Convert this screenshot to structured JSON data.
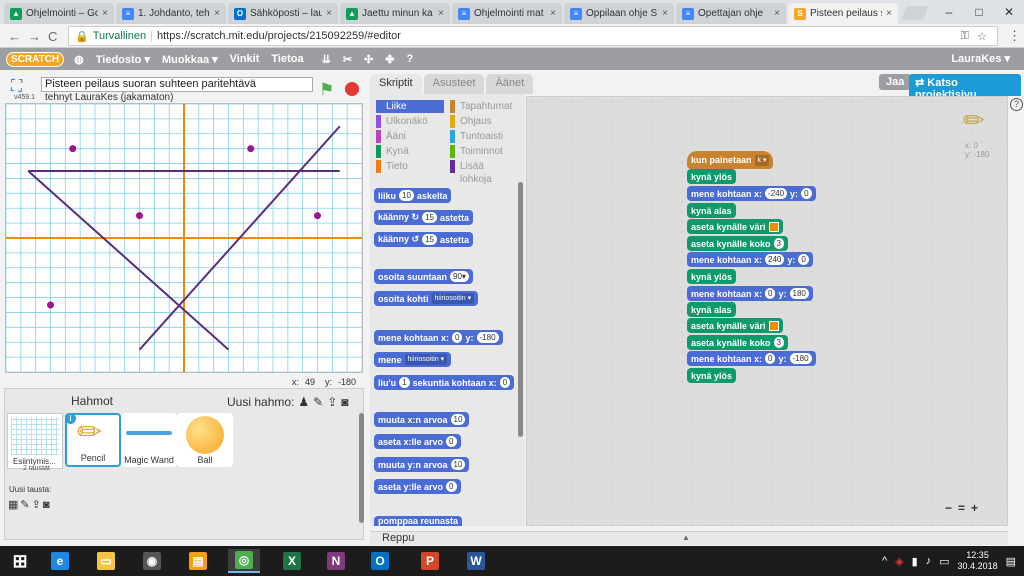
{
  "browser": {
    "tabs": [
      {
        "label": "Ohjelmointi – Go",
        "color": "#0f9d58",
        "glyph": "▲"
      },
      {
        "label": "1. Johdanto, teht",
        "color": "#4285f4",
        "glyph": "≡"
      },
      {
        "label": "Sähköposti – lau",
        "color": "#0072c6",
        "glyph": "O"
      },
      {
        "label": "Jaettu minun ka",
        "color": "#0f9d58",
        "glyph": "▲"
      },
      {
        "label": "Ohjelmointi mat",
        "color": "#4285f4",
        "glyph": "≡"
      },
      {
        "label": "Oppilaan ohje S",
        "color": "#4285f4",
        "glyph": "≡"
      },
      {
        "label": "Opettajan ohje",
        "color": "#4285f4",
        "glyph": "≡"
      },
      {
        "label": "Pisteen peilaus s",
        "color": "#f6a623",
        "glyph": "S"
      }
    ],
    "tab_close": "×",
    "secure_label": "Turvallinen",
    "url": "https://scratch.mit.edu/projects/215092259/#editor",
    "nav": [
      "←",
      "→",
      "C"
    ],
    "min": "–",
    "max": "□",
    "close": "✕"
  },
  "menu": {
    "logo": "SCRATCH",
    "items": [
      "Tiedosto ▾",
      "Muokkaa ▾",
      "Vinkit",
      "Tietoa"
    ],
    "user": "LauraKes ▾",
    "share": "Jaa",
    "see_project": "Katso projektisivu"
  },
  "stage": {
    "project_name": "Pisteen peilaus suoran suhteen paritehtävä",
    "byline": "tehnyt LauraKes (jakamaton)",
    "version": "v459.1",
    "coord_x_label": "x:",
    "coord_x": "49",
    "coord_y_label": "y:",
    "coord_y": "-180"
  },
  "sprites": {
    "header": "Hahmot",
    "new_label": "Uusi hahmo:",
    "stage_name": "Esiintymis...",
    "stage_count": "2 taustat",
    "new_bg": "Uusi tausta:",
    "list": [
      "Pencil",
      "Magic Wand",
      "Ball"
    ]
  },
  "tabs": [
    "Skriptit",
    "Asusteet",
    "Äänet"
  ],
  "categories": [
    {
      "label": "Liike",
      "color": "#4a6cd4"
    },
    {
      "label": "Tapahtumat",
      "color": "#c88330"
    },
    {
      "label": "Ulkonäkö",
      "color": "#8a55d7"
    },
    {
      "label": "Ohjaus",
      "color": "#e1a91a"
    },
    {
      "label": "Ääni",
      "color": "#bb42c3"
    },
    {
      "label": "Tuntoaisti",
      "color": "#2ca5e2"
    },
    {
      "label": "Kynä",
      "color": "#0e9a57"
    },
    {
      "label": "Toiminnot",
      "color": "#5cb712"
    },
    {
      "label": "Tieto",
      "color": "#ee7d16"
    },
    {
      "label": "Lisää lohkoja",
      "color": "#632d99"
    }
  ],
  "palette": {
    "move": "liiku",
    "move_n": "10",
    "steps": "askelta",
    "turn_r": "käänny ↻",
    "turn_n": "15",
    "degrees": "astetta",
    "turn_l": "käänny ↺",
    "point_dir": "osoita suuntaan",
    "dir_n": "90▾",
    "point_to": "osoita kohti",
    "mouse": "hiiriosoitin ▾",
    "goto_xy": "mene kohtaan x:",
    "y_label": "y:",
    "gx": "0",
    "gy": "-180",
    "goto": "mene",
    "glide": "liu'u",
    "glide_n": "1",
    "glide_txt": "sekuntia kohtaan x:",
    "glide_x": "0",
    "change_x": "muuta x:n arvoa",
    "change_x_n": "10",
    "set_x": "aseta x:lle arvo",
    "set_x_n": "0",
    "change_y": "muuta y:n arvoa",
    "change_y_n": "10",
    "set_y": "aseta y:lle arvo",
    "set_y_n": "0",
    "bounce": "pomppaa reunasta"
  },
  "script": {
    "hat": "kun painetaan",
    "key": "k ▾",
    "pen_up": "kynä ylös",
    "pen_down": "kynä alas",
    "goto": "mene kohtaan x:",
    "y": "y:",
    "p1x": "-240",
    "p1y": "0",
    "set_color": "aseta kynälle väri",
    "set_size": "aseta kynälle koko",
    "size": "3",
    "p2x": "240",
    "p2y": "0",
    "p3x": "0",
    "p3y": "180",
    "p4x": "0",
    "p4y": "-180",
    "xy_readout_x": "x: 0",
    "xy_readout_y": "y: -180"
  },
  "zoom": [
    "−",
    "=",
    "+"
  ],
  "backpack": "Reppu",
  "help": "?",
  "taskbar": {
    "time": "12:35",
    "date": "30.4.2018",
    "apps": [
      {
        "glyph": "⊞",
        "color": "transparent"
      },
      {
        "glyph": "e",
        "color": "#1e88e5"
      },
      {
        "glyph": "▭",
        "color": "#f4c542"
      },
      {
        "glyph": "◉",
        "color": "#555"
      },
      {
        "glyph": "▤",
        "color": "#f2a100"
      },
      {
        "glyph": "◎",
        "color": "#4caf50"
      },
      {
        "glyph": "X",
        "color": "#217346"
      },
      {
        "glyph": "N",
        "color": "#80397b"
      },
      {
        "glyph": "O",
        "color": "#0072c6"
      },
      {
        "glyph": "P",
        "color": "#d24726"
      },
      {
        "glyph": "W",
        "color": "#2b579a"
      }
    ]
  },
  "canvas": {
    "grid_color": "#7fd1ea",
    "axis_color": "#f08a00",
    "line_color": "#5b2d82",
    "dot_color": "#a0138f"
  }
}
